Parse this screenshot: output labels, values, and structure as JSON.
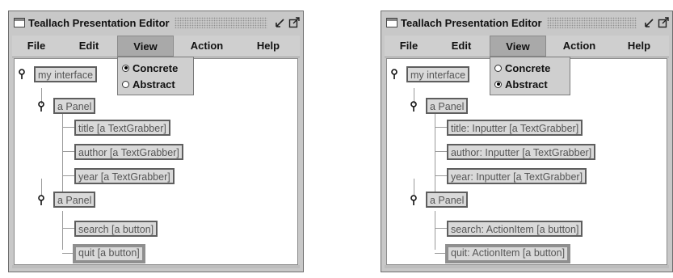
{
  "windows": [
    {
      "title": "Teallach Presentation Editor",
      "menu": [
        "File",
        "Edit",
        "View",
        "Action",
        "Help"
      ],
      "active_menu": "View",
      "view_options": [
        {
          "label": "Concrete",
          "selected": true
        },
        {
          "label": "Abstract",
          "selected": false
        }
      ],
      "tree": {
        "root": "my interface",
        "panel1": "a Panel",
        "panel1_children": [
          "title [a TextGrabber]",
          "author [a TextGrabber]",
          "year [a TextGrabber]"
        ],
        "panel2": "a Panel",
        "panel2_children": [
          "search [a button]",
          "quit [a button]"
        ],
        "selected": "quit [a button]"
      }
    },
    {
      "title": "Teallach Presentation Editor",
      "menu": [
        "File",
        "Edit",
        "View",
        "Action",
        "Help"
      ],
      "active_menu": "View",
      "view_options": [
        {
          "label": "Concrete",
          "selected": false
        },
        {
          "label": "Abstract",
          "selected": true
        }
      ],
      "tree": {
        "root": "my interface",
        "panel1": "a Panel",
        "panel1_children": [
          "title: Inputter [a TextGrabber]",
          "author: Inputter [a TextGrabber]",
          "year: Inputter [a TextGrabber]"
        ],
        "panel2": "a Panel",
        "panel2_children": [
          "search: ActionItem [a button]",
          "quit: ActionItem [a button]"
        ],
        "selected": "quit: ActionItem [a button]"
      }
    }
  ],
  "icons": {
    "window": "window-icon",
    "minimize": "minimize-icon",
    "maximize": "maximize-icon",
    "node_handle": "tree-handle-icon",
    "radio": "radio-icon"
  }
}
